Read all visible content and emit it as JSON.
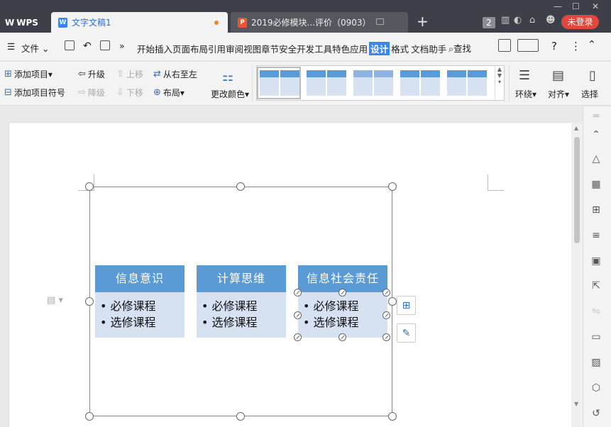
{
  "titlebar": {
    "tabs": [
      {
        "label": "WPS"
      },
      {
        "label": "文字文稿1"
      },
      {
        "label": "2019必修模块...评价（0903）"
      }
    ],
    "new_tab": "+",
    "badge": "2",
    "login": "未登录"
  },
  "menubar": {
    "file": "文件",
    "more": "»",
    "items": [
      "开始",
      "插入",
      "页面布局",
      "引用",
      "审阅",
      "视图",
      "章节",
      "安全",
      "开发工具",
      "特色应用",
      "设计",
      "格式",
      "文档助手"
    ],
    "active": "设计",
    "search": "查找",
    "help": "?",
    "more_dots": "⋮"
  },
  "ribbon": {
    "add_item": "添加项目",
    "add_bullet": "添加项目符号",
    "promote": "升级",
    "demote": "降级",
    "move_up": "上移",
    "move_down": "下移",
    "right_to_left": "从右至左",
    "layout": "布局",
    "change_color": "更改颜色",
    "wrap": "环绕",
    "align": "对齐",
    "select": "选择"
  },
  "smartart": {
    "shapes": [
      {
        "title": "信息意识",
        "bullets": [
          "必修课程",
          "选修课程"
        ]
      },
      {
        "title": "计算思维",
        "bullets": [
          "必修课程",
          "选修课程"
        ]
      },
      {
        "title": "信息社会责任",
        "bullets": [
          "必修课程",
          "选修课程"
        ]
      }
    ]
  },
  "colors": {
    "titlebar": "#3d4048",
    "accent": "#3b86e8",
    "shape_head": "#5b9bd5",
    "shape_body": "#d6e1f2",
    "login": "#e0473d"
  }
}
